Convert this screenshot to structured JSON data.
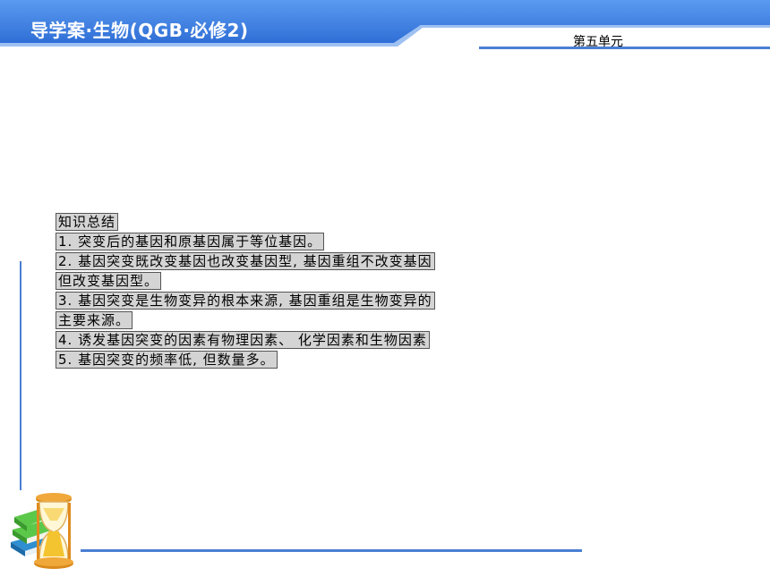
{
  "header": {
    "title": "导学案·生物(QGB·必修2)",
    "unit": "第五单元"
  },
  "summary": {
    "heading": "知识总结",
    "lines": [
      "1. 突变后的基因和原基因属于等位基因。",
      "2. 基因突变既改变基因也改变基因型, 基因重组不改变基因",
      "但改变基因型。",
      "3. 基因突变是生物变异的根本来源, 基因重组是生物变异的",
      "主要来源。",
      "4. 诱发基因突变的因素有物理因素、 化学因素和生物因素",
      "5. 基因突变的频率低, 但数量多。"
    ]
  },
  "colors": {
    "header_blue": "#3e7fe0",
    "accent_line": "#4a7fd4",
    "highlight_bg": "#d4d4d4"
  },
  "icons": [
    "hourglass-books-icon"
  ]
}
